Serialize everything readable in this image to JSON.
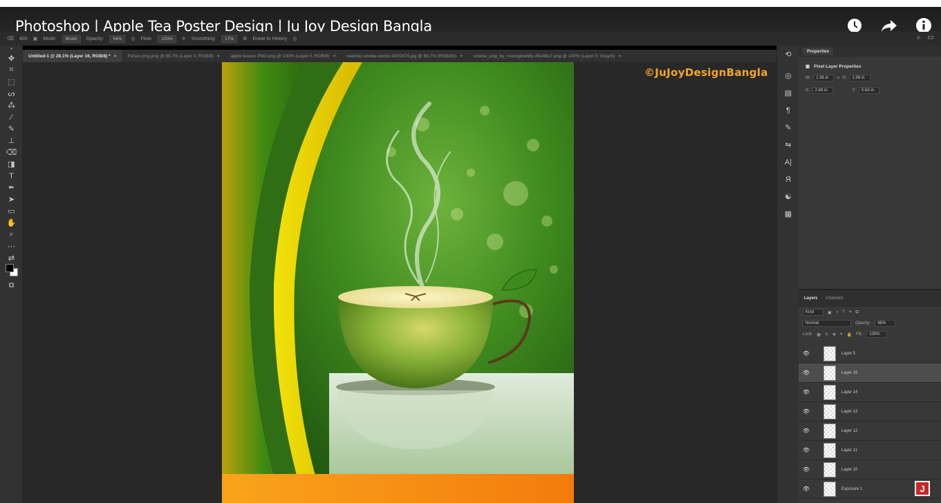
{
  "video": {
    "title": "Photoshop | Apple Tea Poster Design | Ju Joy Design Bangla",
    "watermark": "©JuJoyDesignBangla",
    "channel_logo_letter": "J"
  },
  "options_bar": {
    "brush_size": "400",
    "mode_label": "Mode:",
    "mode_value": "Brush",
    "opacity_label": "Opacity:",
    "opacity_value": "54%",
    "flow_label": "Flow:",
    "flow_value": "100%",
    "smoothing_label": "Smoothing:",
    "smoothing_value": "17%",
    "erase_to_history": "Erase to History"
  },
  "tabs": [
    {
      "label": "Untitled-1 @ 28.1% (Layer 16, RGB/8) *",
      "active": true
    },
    {
      "label": "Pulses png.png @ 66.7% (Layer 0, RGB/8)",
      "active": false
    },
    {
      "label": "apple leaves PNG.png @ 100% (Layer 0, RGB/8)",
      "active": false
    },
    {
      "label": "realistic-smoke-vector-4200474.jpg @ 66.7% (RGB/8#)",
      "active": false
    },
    {
      "label": "smoke_png_by_moonglowlilly-d5e4bu7.png @ 100% (Layer 0, Gray/8)",
      "active": false
    }
  ],
  "properties": {
    "tab": "Properties",
    "header": "Pixel Layer Properties",
    "w_label": "W:",
    "w_value": "1.36 in",
    "h_label": "H:",
    "h_value": "1.99 in",
    "x_label": "X:",
    "x_value": "2.69 in",
    "y_label": "Y:",
    "y_value": "5.63 in"
  },
  "layers_panel": {
    "tab_layers": "Layers",
    "tab_channels": "Channels",
    "kind": "Kind",
    "blend_mode": "Normal",
    "opacity_label": "Opacity:",
    "opacity_value": "46%",
    "lock_label": "Lock:",
    "fill_label": "Fill:",
    "fill_value": "100%",
    "layers": [
      {
        "name": "Layer 5",
        "selected": false
      },
      {
        "name": "Layer 16",
        "selected": true
      },
      {
        "name": "Layer 14",
        "selected": false
      },
      {
        "name": "Layer 13",
        "selected": false
      },
      {
        "name": "Layer 12",
        "selected": false
      },
      {
        "name": "Layer 11",
        "selected": false
      },
      {
        "name": "Layer 10",
        "selected": false
      },
      {
        "name": "Exposure 1",
        "selected": false
      }
    ]
  }
}
